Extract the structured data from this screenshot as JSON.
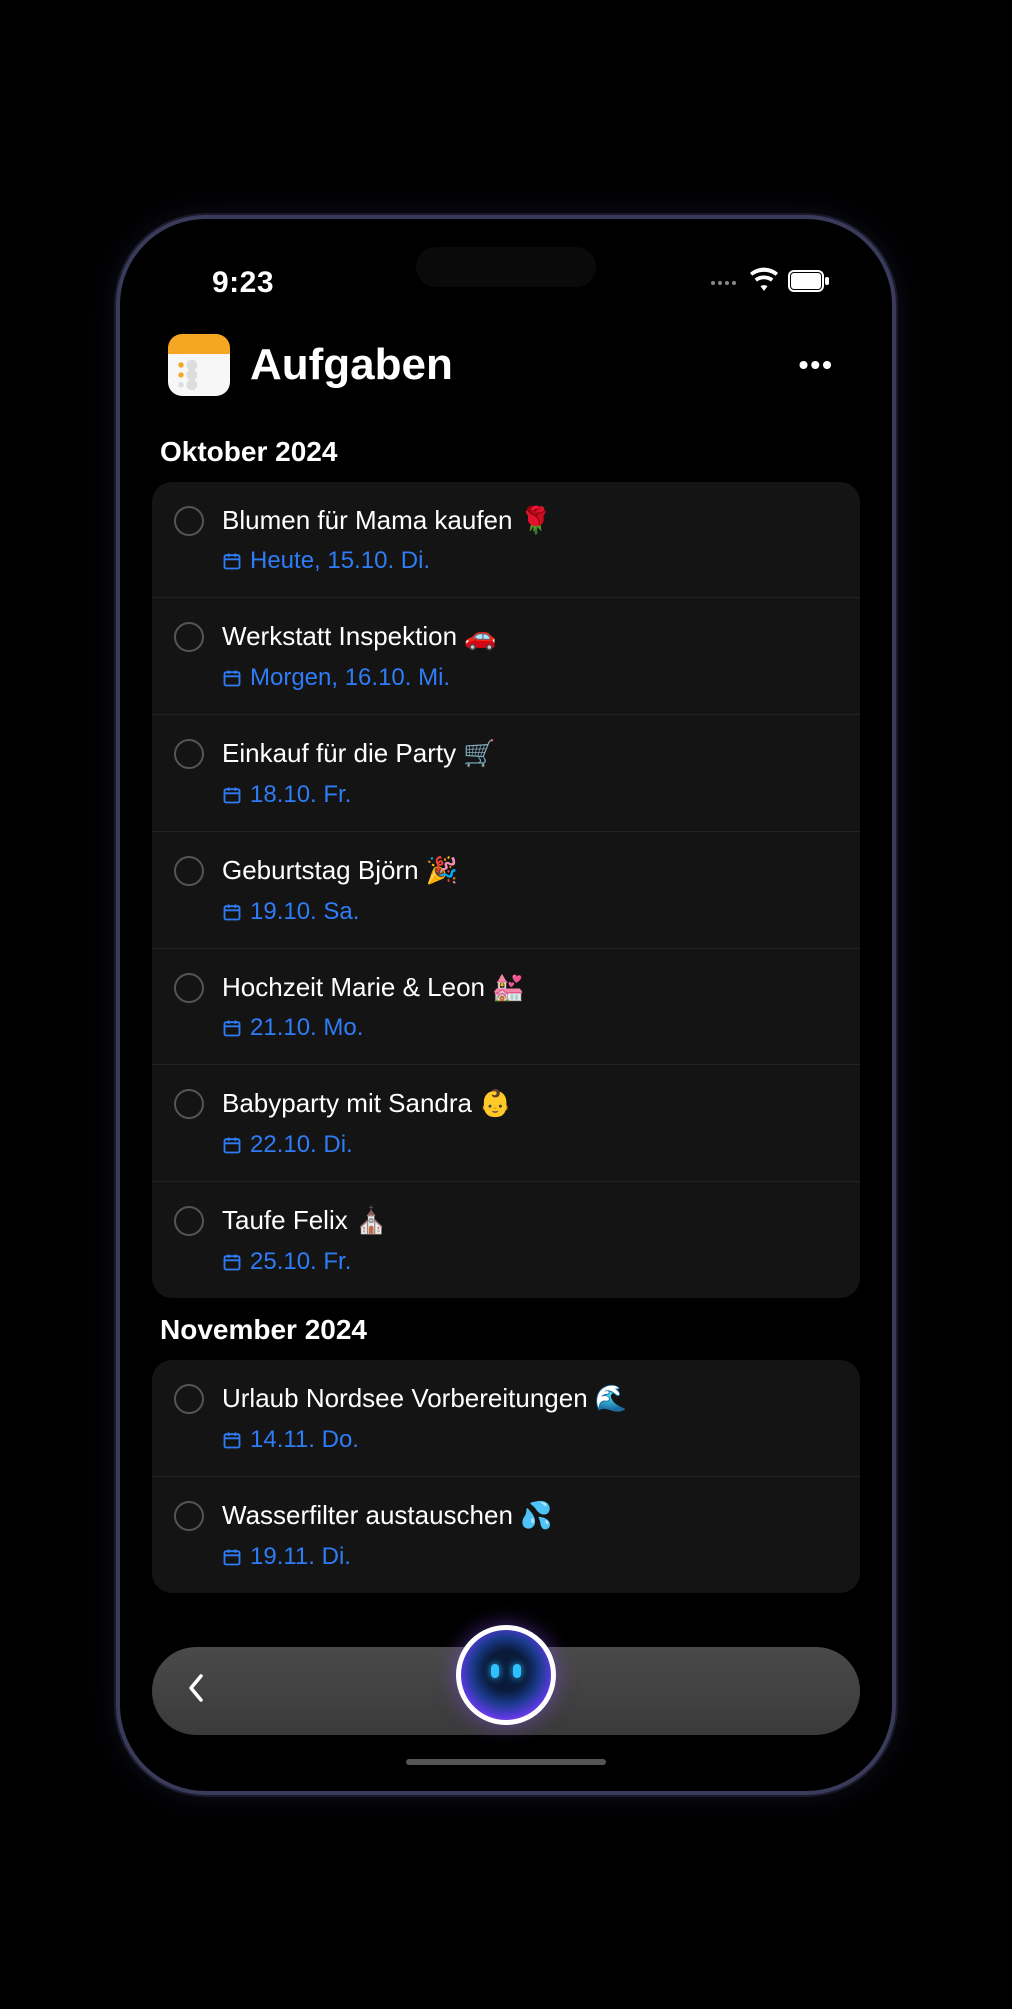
{
  "status": {
    "time": "9:23"
  },
  "header": {
    "title": "Aufgaben"
  },
  "sections": [
    {
      "title": "Oktober 2024",
      "tasks": [
        {
          "title": "Blumen für Mama kaufen 🌹",
          "date": "Heute, 15.10. Di."
        },
        {
          "title": "Werkstatt Inspektion 🚗",
          "date": "Morgen, 16.10. Mi."
        },
        {
          "title": "Einkauf für die Party 🛒",
          "date": "18.10. Fr."
        },
        {
          "title": "Geburtstag Björn 🎉",
          "date": "19.10. Sa."
        },
        {
          "title": "Hochzeit Marie & Leon 💒",
          "date": "21.10. Mo."
        },
        {
          "title": "Babyparty mit Sandra 👶",
          "date": "22.10. Di."
        },
        {
          "title": "Taufe Felix ⛪",
          "date": "25.10. Fr."
        }
      ]
    },
    {
      "title": "November 2024",
      "tasks": [
        {
          "title": "Urlaub Nordsee Vorbereitungen 🌊",
          "date": "14.11. Do."
        },
        {
          "title": "Wasserfilter austauschen 💦",
          "date": "19.11. Di."
        }
      ]
    }
  ]
}
